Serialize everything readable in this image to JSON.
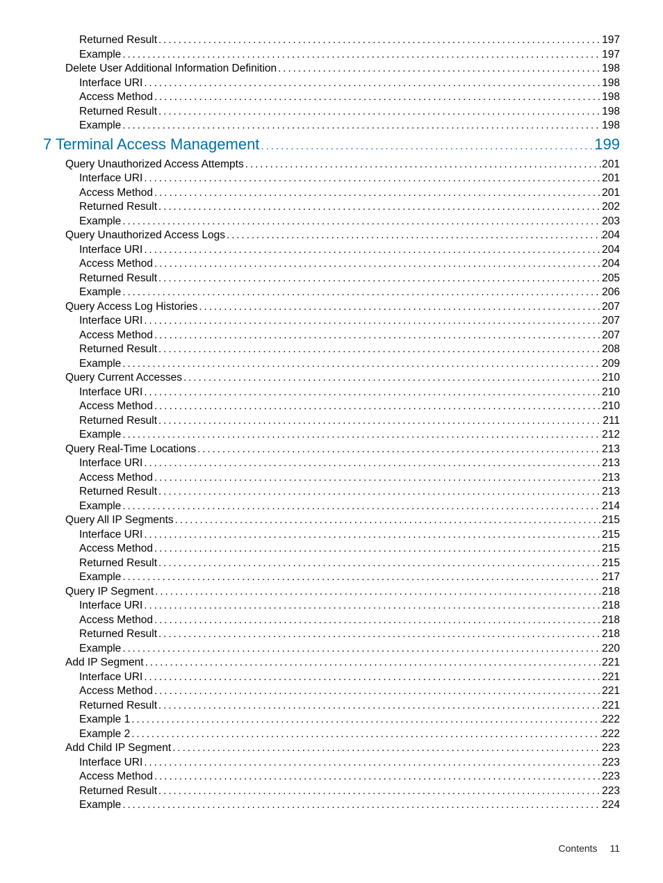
{
  "toc": [
    {
      "level": "l2",
      "label": "Returned Result",
      "page": "197"
    },
    {
      "level": "l2",
      "label": "Example",
      "page": "197"
    },
    {
      "level": "l1",
      "label": "Delete User Additional Information Definition",
      "page": "198"
    },
    {
      "level": "l2",
      "label": "Interface URI",
      "page": "198"
    },
    {
      "level": "l2",
      "label": "Access Method",
      "page": "198"
    },
    {
      "level": "l2",
      "label": "Returned Result",
      "page": "198"
    },
    {
      "level": "l2",
      "label": "Example",
      "page": "198"
    },
    {
      "level": "chapter",
      "label": "7 Terminal Access Management",
      "page": "199"
    },
    {
      "level": "l1",
      "label": "Query Unauthorized Access Attempts",
      "page": "201"
    },
    {
      "level": "l2",
      "label": "Interface URI",
      "page": "201"
    },
    {
      "level": "l2",
      "label": "Access Method",
      "page": "201"
    },
    {
      "level": "l2",
      "label": "Returned Result",
      "page": "202"
    },
    {
      "level": "l2",
      "label": "Example",
      "page": "203"
    },
    {
      "level": "l1",
      "label": "Query Unauthorized Access Logs",
      "page": "204"
    },
    {
      "level": "l2",
      "label": "Interface URI",
      "page": "204"
    },
    {
      "level": "l2",
      "label": "Access Method",
      "page": "204"
    },
    {
      "level": "l2",
      "label": "Returned Result",
      "page": "205"
    },
    {
      "level": "l2",
      "label": "Example",
      "page": "206"
    },
    {
      "level": "l1",
      "label": "Query Access Log Histories",
      "page": "207"
    },
    {
      "level": "l2",
      "label": "Interface URI",
      "page": "207"
    },
    {
      "level": "l2",
      "label": "Access Method",
      "page": "207"
    },
    {
      "level": "l2",
      "label": "Returned Result",
      "page": "208"
    },
    {
      "level": "l2",
      "label": "Example",
      "page": "209"
    },
    {
      "level": "l1",
      "label": "Query Current Accesses",
      "page": "210"
    },
    {
      "level": "l2",
      "label": "Interface URI",
      "page": "210"
    },
    {
      "level": "l2",
      "label": "Access Method",
      "page": "210"
    },
    {
      "level": "l2",
      "label": "Returned Result",
      "page": "211"
    },
    {
      "level": "l2",
      "label": "Example",
      "page": "212"
    },
    {
      "level": "l1",
      "label": "Query Real-Time Locations",
      "page": "213"
    },
    {
      "level": "l2",
      "label": "Interface URI",
      "page": "213"
    },
    {
      "level": "l2",
      "label": "Access Method",
      "page": "213"
    },
    {
      "level": "l2",
      "label": "Returned Result",
      "page": "213"
    },
    {
      "level": "l2",
      "label": "Example",
      "page": "214"
    },
    {
      "level": "l1",
      "label": "Query All IP Segments",
      "page": "215"
    },
    {
      "level": "l2",
      "label": "Interface URI",
      "page": "215"
    },
    {
      "level": "l2",
      "label": "Access Method",
      "page": "215"
    },
    {
      "level": "l2",
      "label": "Returned Result",
      "page": "215"
    },
    {
      "level": "l2",
      "label": "Example",
      "page": "217"
    },
    {
      "level": "l1",
      "label": "Query IP Segment",
      "page": "218"
    },
    {
      "level": "l2",
      "label": "Interface URI",
      "page": "218"
    },
    {
      "level": "l2",
      "label": "Access Method",
      "page": "218"
    },
    {
      "level": "l2",
      "label": "Returned Result",
      "page": "218"
    },
    {
      "level": "l2",
      "label": "Example",
      "page": "220"
    },
    {
      "level": "l1",
      "label": "Add IP Segment",
      "page": "221"
    },
    {
      "level": "l2",
      "label": "Interface URI",
      "page": "221"
    },
    {
      "level": "l2",
      "label": "Access Method",
      "page": "221"
    },
    {
      "level": "l2",
      "label": "Returned Result",
      "page": "221"
    },
    {
      "level": "l2",
      "label": "Example 1",
      "page": "222"
    },
    {
      "level": "l2",
      "label": "Example 2",
      "page": "222"
    },
    {
      "level": "l1",
      "label": "Add Child IP Segment",
      "page": "223"
    },
    {
      "level": "l2",
      "label": "Interface URI",
      "page": "223"
    },
    {
      "level": "l2",
      "label": "Access Method",
      "page": "223"
    },
    {
      "level": "l2",
      "label": "Returned Result",
      "page": "223"
    },
    {
      "level": "l2",
      "label": "Example",
      "page": "224"
    }
  ],
  "footer": {
    "label": "Contents",
    "page": "11"
  }
}
